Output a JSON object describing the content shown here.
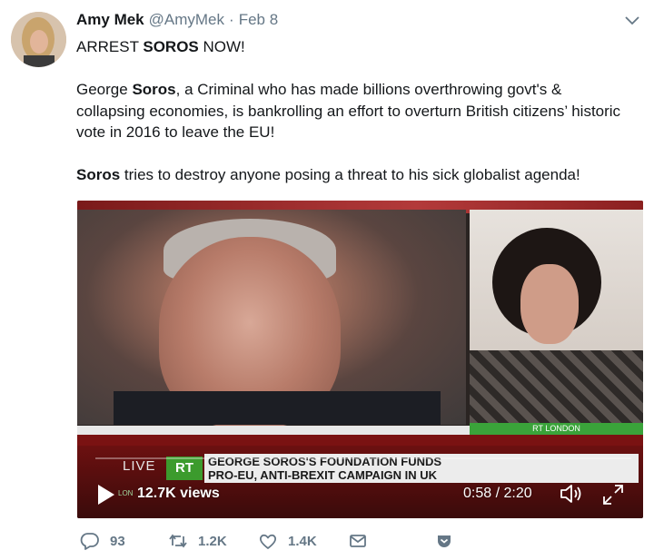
{
  "author": {
    "name": "Amy Mek",
    "handle": "@AmyMek",
    "separator": "·",
    "date": "Feb 8"
  },
  "tweet": {
    "line1_pre": "ARREST ",
    "line1_bold": "SOROS",
    "line1_post": " NOW!",
    "p2_l1_pre": "George ",
    "p2_l1_bold": "Soros",
    "p2_l1_post": ", a Criminal who has made billions overthrowing govt's &",
    "p2_l2": "collapsing economies, is bankrolling an effort to overturn British citizens’ historic",
    "p2_l3": "vote in 2016 to leave the EU!",
    "p3_bold": "Soros",
    "p3_post": " tries to destroy anyone posing a threat to his sick globalist agenda!"
  },
  "video": {
    "live_label": "LIVE",
    "logo_text": "RT",
    "channel_label": "RT LONDON",
    "headline_line1": "GEORGE SOROS'S FOUNDATION FUNDS",
    "headline_line2": "PRO-EU, ANTI-BREXIT CAMPAIGN IN UK",
    "lower_label": "LON",
    "views": "12.7K views",
    "time": "0:58 / 2:20"
  },
  "actions": {
    "reply_count": "93",
    "retweet_count": "1.2K",
    "like_count": "1.4K"
  },
  "colors": {
    "text": "#14171a",
    "muted": "#657786",
    "rt_green": "#3c9b2d"
  },
  "icons": [
    "chevron-down-icon",
    "play-icon",
    "volume-icon",
    "fullscreen-icon",
    "reply-icon",
    "retweet-icon",
    "like-icon",
    "direct-message-icon",
    "save-icon"
  ]
}
